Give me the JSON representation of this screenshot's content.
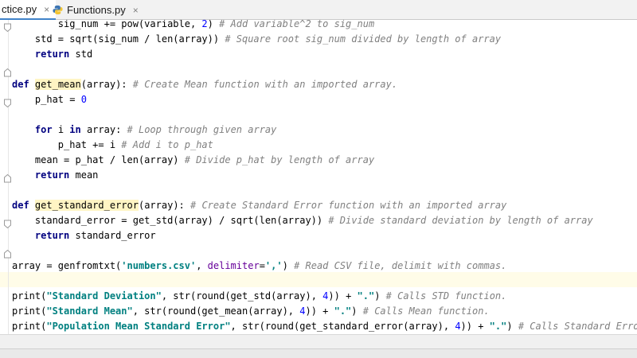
{
  "tabs": [
    {
      "label": "ctice.py",
      "active": true
    },
    {
      "label": "Functions.py",
      "active": false
    }
  ],
  "close_glyph": "×",
  "colors": {
    "keyword": "#000080",
    "string": "#008080",
    "number": "#0000ff",
    "comment": "#808080",
    "param": "#660099",
    "tab_accent": "#4083c9",
    "caret_row": "#fffce8"
  },
  "code": {
    "l1": {
      "a": "        sig_num += pow(variable, ",
      "n": "2",
      "b": ") ",
      "c": "# Add variable^2 to sig_num"
    },
    "l2": {
      "a": "    std = sqrt(sig_num / len(array)) ",
      "c": "# Square root sig_num divided by length of array"
    },
    "l3": {
      "kw": "return",
      "a": " std"
    },
    "l5": {
      "kw": "def",
      "fn": "get_mean",
      "a": "(array): ",
      "c": "# Create Mean function with an imported array."
    },
    "l6": {
      "a": "    p_hat = ",
      "n": "0"
    },
    "l8": {
      "kw1": "for",
      "a": " i ",
      "kw2": "in",
      "b": " array: ",
      "c": "# Loop through given array"
    },
    "l9": {
      "a": "        p_hat += i ",
      "c": "# Add i to p_hat"
    },
    "l10": {
      "a": "    mean = p_hat / len(array) ",
      "c": "# Divide p_hat by length of array"
    },
    "l11": {
      "kw": "return",
      "a": " mean"
    },
    "l13": {
      "kw": "def",
      "fn": "get_standard_error",
      "a": "(array): ",
      "c": "# Create Standard Error function with an imported array"
    },
    "l14": {
      "a": "    standard_error = get_std(array) / sqrt(len(array)) ",
      "c": "# Divide standard deviation by length of array"
    },
    "l15": {
      "kw": "return",
      "a": " standard_error"
    },
    "l17": {
      "a": "array = genfromtxt(",
      "s1": "'numbers.csv'",
      "b": ", ",
      "p": "delimiter",
      "d": "=",
      "s2": "','",
      "e": ") ",
      "c": "# Read CSV file, delimit with commas."
    },
    "l19": {
      "a": "print(",
      "s1": "\"Standard Deviation\"",
      "b": ", str(round(get_std(array), ",
      "n": "4",
      "d": ")) + ",
      "s2": "\".\"",
      "e": ") ",
      "c": "# Calls STD function."
    },
    "l20": {
      "a": "print(",
      "s1": "\"Standard Mean\"",
      "b": ", str(round(get_mean(array), ",
      "n": "4",
      "d": ")) + ",
      "s2": "\".\"",
      "e": ") ",
      "c": "# Calls Mean function."
    },
    "l21": {
      "a": "print(",
      "s1": "\"Population Mean Standard Error\"",
      "b": ", str(round(get_standard_error(array), ",
      "n": "4",
      "d": ")) + ",
      "s2": "\".\"",
      "e": ") ",
      "c": "# Calls Standard Error function."
    }
  }
}
